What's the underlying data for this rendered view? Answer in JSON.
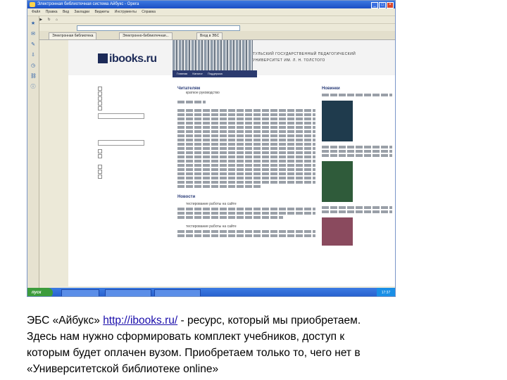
{
  "browser": {
    "title": "Электронная библиотечная система Айбукс - Opera",
    "menu": [
      "Файл",
      "Правка",
      "Вид",
      "Закладки",
      "Виджеты",
      "Инструменты",
      "Справка"
    ],
    "tabs": [
      "Электронная библиотека",
      "Электронно-библиотечная...",
      "Вход в ЭБС"
    ]
  },
  "site": {
    "logo_text": "ibooks.ru",
    "uni_lines": [
      "ТУЛЬСКИЙ ГОСУДАРСТВЕННЫЙ ПЕДАГОГИЧЕСКИЙ",
      "УНИВЕРСИТЕТ ИМ. Л. Н. ТОЛСТОГО"
    ],
    "nav": [
      "Главная",
      "Каталог",
      "Поддержка"
    ],
    "sections": {
      "readers": "Читателям",
      "readers_sub": "краткое руководство",
      "news": "Новости",
      "news_item": "тестирование работы на сайте",
      "new_books": "Новинки"
    }
  },
  "taskbar": {
    "start": "пуск",
    "clock": "17:37"
  },
  "caption": {
    "prefix": "ЭБС «Айбукс» ",
    "link": "http://ibooks.ru/",
    "rest_line1": " - ресурс, который мы приобретаем.",
    "line2": "Здесь нам нужно сформировать комплект учебников, доступ к",
    "line3": "которым будет оплачен вузом. Приобретаем только то, чего нет в",
    "line4": "«Университетской библиотеке online»"
  }
}
